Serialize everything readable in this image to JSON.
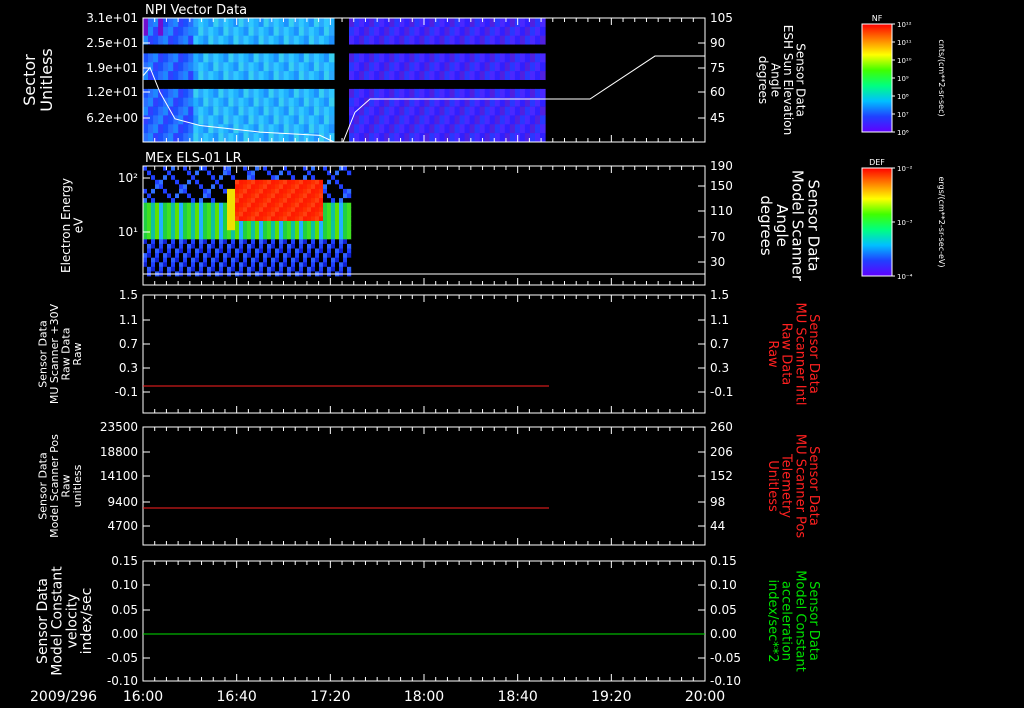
{
  "colors": {
    "background": "#000000",
    "axis": "#ffffff",
    "red": "#ff2020",
    "green": "#00e000"
  },
  "chart_data": [
    {
      "type": "heatmap",
      "title": "NPI Vector Data",
      "ylabel": "Sector\nUnitless",
      "yticks": [
        "3.1e+01",
        "2.5e+01",
        "1.9e+01",
        "1.2e+01",
        "6.2e+00"
      ],
      "ylabel_right": "Sensor Data\nESH Sun Elevation\nAngle\ndegrees",
      "yticks_right": [
        "105",
        "90",
        "75",
        "60",
        "45"
      ],
      "colorbar": {
        "label": "NF",
        "unit": "cnts/(cm**2-sr-sec)",
        "ticks": [
          "10¹²",
          "10¹¹",
          "10¹⁰",
          "10⁹",
          "10⁸",
          "10⁷",
          "10⁶"
        ]
      },
      "series": [
        {
          "type": "line",
          "x": [
            0,
            0.05,
            0.08,
            0.15,
            0.22,
            0.3,
            0.4,
            0.52,
            0.57,
            0.62,
            0.66,
            0.7,
            0.75,
            0.8,
            0.85,
            0.9,
            0.95,
            1.0
          ],
          "y": [
            70,
            75,
            72,
            52,
            44,
            40,
            38,
            36,
            34,
            30,
            52,
            56,
            56,
            56,
            56,
            56,
            56,
            56
          ]
        },
        {
          "type": "line",
          "x": [
            1.0,
            1.05,
            1.1,
            1.15,
            1.25,
            1.3,
            1.35
          ],
          "y": [
            56,
            56,
            62,
            72,
            82,
            82,
            82
          ]
        }
      ]
    },
    {
      "type": "heatmap",
      "title": "MEx ELS-01 LR",
      "ylabel": "Electron Energy\neV",
      "yticks": [
        "10²",
        "10¹"
      ],
      "ylabel_right": "Sensor Data\nModel Scanner\nAngle\ndegrees",
      "yticks_right": [
        "190",
        "150",
        "110",
        "70",
        "30"
      ],
      "colorbar": {
        "label": "DEF",
        "unit": "ergs/(cm**2-sr-sec-eV)",
        "ticks": [
          "10⁻²",
          "10⁻³",
          "10⁻⁴"
        ]
      }
    },
    {
      "type": "line",
      "ylabel": "Sensor Data\nMU Scanner +30V\nRaw Data\nRaw",
      "yticks": [
        "1.5",
        "1.1",
        "0.7",
        "0.3",
        "-0.1"
      ],
      "ylabel_right": "Sensor Data\nMU Scanner Intl\nRaw Data\nRaw",
      "yticks_right": [
        "1.5",
        "1.1",
        "0.7",
        "0.3",
        "-0.1"
      ],
      "ylim": [
        -0.4,
        1.5
      ],
      "series": [
        {
          "color": "#ff2020",
          "x_end_fraction": 0.735,
          "values": [
            0,
            0
          ]
        }
      ]
    },
    {
      "type": "line",
      "ylabel": "Sensor Data\nModel Scanner Pos\nRaw\nunitless",
      "yticks": [
        "23500",
        "18800",
        "14100",
        "9400",
        "4700"
      ],
      "ylabel_right": "Sensor Data\nMU Scanner Pos\nTelemetry\nUnitless",
      "yticks_right": [
        "260",
        "206",
        "152",
        "98",
        "44"
      ],
      "ylim": [
        0,
        23500
      ],
      "series": [
        {
          "color": "#ff2020",
          "x_end_fraction": 0.735,
          "values": [
            8300,
            8300
          ]
        }
      ]
    },
    {
      "type": "line",
      "ylabel": "Sensor Data\nModel Constant\nvelocity\nindex/sec",
      "yticks": [
        "0.15",
        "0.10",
        "0.05",
        "0.00",
        "-0.05",
        "-0.10"
      ],
      "ylabel_right": "Sensor Data\nModel Constant\nacceleration\nindex/sec**2",
      "yticks_right": [
        "0.15",
        "0.10",
        "0.05",
        "0.00",
        "-0.05",
        "-0.10"
      ],
      "ylim": [
        -0.1,
        0.15
      ],
      "series": [
        {
          "color": "#00e000",
          "values": [
            0,
            0
          ]
        }
      ]
    }
  ],
  "xaxis": {
    "date": "2009/296",
    "ticks": [
      "16:00",
      "16:40",
      "17:20",
      "18:00",
      "18:40",
      "19:20",
      "20:00"
    ]
  }
}
